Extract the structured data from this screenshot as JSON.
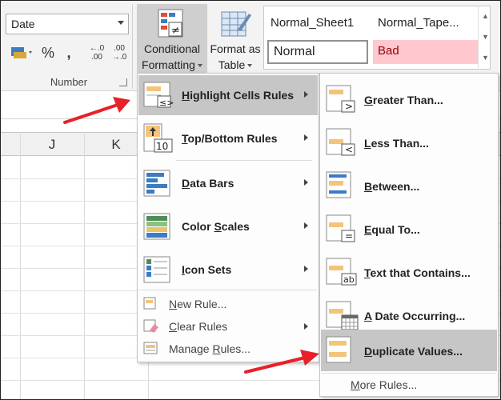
{
  "ribbon": {
    "number_format_value": "Date",
    "number_group_label": "Number",
    "percent_symbol": "%",
    "comma_symbol": ",",
    "increase_decimal_top": "←.0",
    "increase_decimal_bottom": ".00",
    "decrease_decimal_top": ".00",
    "decrease_decimal_bottom": "→.0",
    "conditional_formatting_line1": "Conditional",
    "conditional_formatting_line2": "Formatting",
    "format_as_table_line1": "Format as",
    "format_as_table_line2": "Table",
    "styles": {
      "normal_sheet1": "Normal_Sheet1",
      "normal_tape": "Normal_Tape...",
      "normal": "Normal",
      "bad": "Bad"
    }
  },
  "grid": {
    "columns": [
      "J",
      "K"
    ]
  },
  "menu_main": {
    "items": [
      {
        "pre": "",
        "ul": "H",
        "post": "ighlight Cells Rules"
      },
      {
        "pre": "",
        "ul": "T",
        "post": "op/Bottom Rules"
      },
      {
        "pre": "",
        "ul": "D",
        "post": "ata Bars"
      },
      {
        "pre": "Color ",
        "ul": "S",
        "post": "cales"
      },
      {
        "pre": "",
        "ul": "I",
        "post": "con Sets"
      },
      {
        "pre": "",
        "ul": "N",
        "post": "ew Rule..."
      },
      {
        "pre": "",
        "ul": "C",
        "post": "lear Rules"
      },
      {
        "pre": "Manage ",
        "ul": "R",
        "post": "ules..."
      }
    ],
    "topbottom_icon_text": "10"
  },
  "menu_sub": {
    "items": [
      {
        "pre": "",
        "ul": "G",
        "post": "reater Than..."
      },
      {
        "pre": "",
        "ul": "L",
        "post": "ess Than..."
      },
      {
        "pre": "",
        "ul": "B",
        "post": "etween..."
      },
      {
        "pre": "",
        "ul": "E",
        "post": "qual To..."
      },
      {
        "pre": "",
        "ul": "T",
        "post": "ext that Contains..."
      },
      {
        "pre": "",
        "ul": "A",
        "post": " Date Occurring..."
      },
      {
        "pre": "",
        "ul": "D",
        "post": "uplicate Values..."
      },
      {
        "pre": "",
        "ul": "M",
        "post": "ore Rules..."
      }
    ],
    "icon_symbols": [
      ">",
      "<",
      "",
      "=",
      "ab",
      "",
      ""
    ]
  },
  "colors": {
    "highlight": "#c6c6c6",
    "bad_fill": "#ffc7ce",
    "bad_text": "#9c0006",
    "arrow_red": "#e8202a",
    "cell_orange": "#f4c47a"
  }
}
